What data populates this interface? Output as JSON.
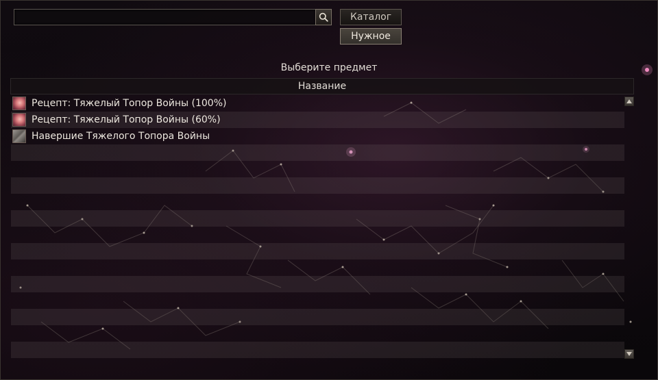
{
  "search": {
    "value": "",
    "placeholder": ""
  },
  "tabs": {
    "catalog_label": "Каталог",
    "needed_label": "Нужное"
  },
  "section": {
    "title": "Выберите предмет"
  },
  "table": {
    "column_header": "Название",
    "rows": [
      {
        "name": "Рецепт: Тяжелый Топор Войны (100%)",
        "icon": "recipe-scroll-icon"
      },
      {
        "name": "Рецепт: Тяжелый Топор Войны (60%)",
        "icon": "recipe-scroll-icon"
      },
      {
        "name": "Навершие Тяжелого Топора Войны",
        "icon": "axe-pommel-icon"
      },
      {
        "name": "",
        "icon": ""
      },
      {
        "name": "",
        "icon": ""
      },
      {
        "name": "",
        "icon": ""
      },
      {
        "name": "",
        "icon": ""
      },
      {
        "name": "",
        "icon": ""
      },
      {
        "name": "",
        "icon": ""
      },
      {
        "name": "",
        "icon": ""
      },
      {
        "name": "",
        "icon": ""
      },
      {
        "name": "",
        "icon": ""
      },
      {
        "name": "",
        "icon": ""
      },
      {
        "name": "",
        "icon": ""
      },
      {
        "name": "",
        "icon": ""
      },
      {
        "name": "",
        "icon": ""
      }
    ]
  },
  "colors": {
    "accent_border": "#8a8074",
    "row_stripe": "#787070",
    "background": "#0b080b"
  }
}
